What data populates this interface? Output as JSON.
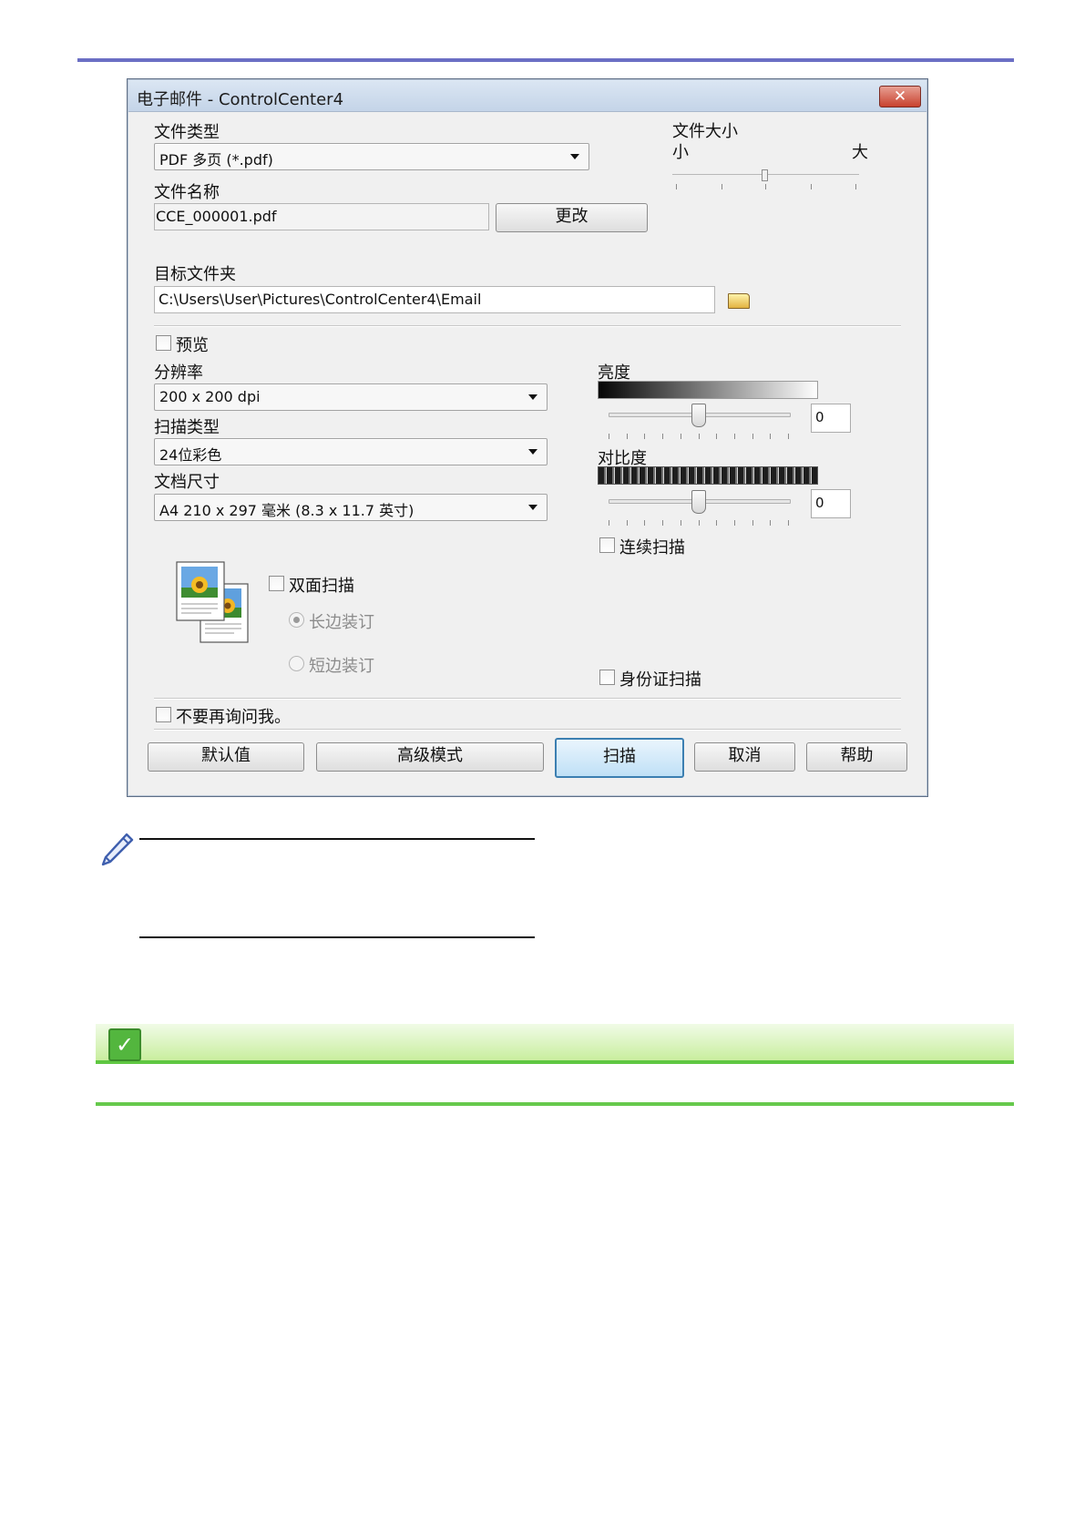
{
  "dialog": {
    "title": "电子邮件 - ControlCenter4",
    "close_glyph": "✕",
    "file_type": {
      "label": "文件类型",
      "value": "PDF 多页 (*.pdf)"
    },
    "file_size": {
      "label": "文件大小",
      "min_label": "小",
      "max_label": "大",
      "level": 0.5
    },
    "file_name": {
      "label": "文件名称",
      "value": "CCE_000001.pdf",
      "change_button": "更改"
    },
    "dest_folder": {
      "label": "目标文件夹",
      "value": "C:\\Users\\User\\Pictures\\ControlCenter4\\Email"
    },
    "preview": {
      "label": "预览",
      "checked": false
    },
    "resolution": {
      "label": "分辨率",
      "value": "200 x 200 dpi"
    },
    "scan_type": {
      "label": "扫描类型",
      "value": "24位彩色"
    },
    "doc_size": {
      "label": "文档尺寸",
      "value": "A4 210 x 297 毫米 (8.3 x 11.7 英寸)"
    },
    "brightness": {
      "label": "亮度",
      "value": "0",
      "level": 0.5
    },
    "contrast": {
      "label": "对比度",
      "value": "0",
      "level": 0.5
    },
    "continuous_scan": {
      "label": "连续扫描",
      "checked": false
    },
    "duplex": {
      "label": "双面扫描",
      "checked": false,
      "long_edge": "长边装订",
      "short_edge": "短边装订"
    },
    "id_scan": {
      "label": "身份证扫描",
      "checked": false
    },
    "dont_ask": {
      "label": "不要再询问我。",
      "checked": false
    },
    "buttons": {
      "default": "默认值",
      "advanced": "高级模式",
      "scan": "扫描",
      "cancel": "取消",
      "help": "帮助"
    }
  },
  "colors": {
    "title_rule": "#6b6fc4",
    "green_accent": "#5fc742"
  },
  "icons": {
    "folder": "folder-icon",
    "pencil": "pencil-icon",
    "check": "check-icon",
    "duplex": "duplex-document-icon"
  }
}
